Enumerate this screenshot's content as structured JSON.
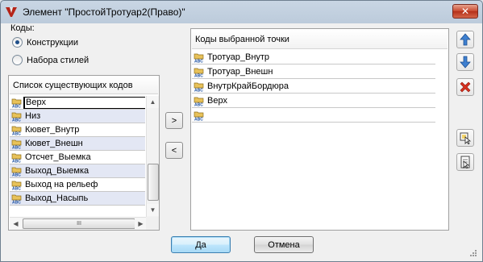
{
  "window": {
    "title": "Элемент \"ПростойТротуар2(Право)\"",
    "close_label": "✕",
    "accent": "#c7472d"
  },
  "codes_group": {
    "label": "Коды:",
    "options": [
      {
        "label": "Конструкции",
        "checked": true
      },
      {
        "label": "Набора стилей",
        "checked": false
      }
    ]
  },
  "existing_list": {
    "header": "Список существующих кодов",
    "items": [
      "Верх",
      "Низ",
      "Кювет_Внутр",
      "Кювет_Внешн",
      "Отсчет_Выемка",
      "Выход_Выемка",
      "Выход на рельеф",
      "Выход_Насыпь"
    ],
    "selected_index": 0,
    "hscroll_glyph": "III"
  },
  "transfer": {
    "add_label": ">",
    "remove_label": "<"
  },
  "selected_list": {
    "header": "Коды выбранной точки",
    "items": [
      "Тротуар_Внутр",
      "Тротуар_Внешн",
      "ВнутрКрайБордюра",
      "Верх",
      ""
    ]
  },
  "side_tools": [
    {
      "name": "move-up-icon"
    },
    {
      "name": "move-down-icon"
    },
    {
      "name": "delete-icon"
    },
    {
      "name": "select-point-icon"
    },
    {
      "name": "pick-point-icon"
    }
  ],
  "footer": {
    "ok_label": "Да",
    "cancel_label": "Отмена"
  }
}
